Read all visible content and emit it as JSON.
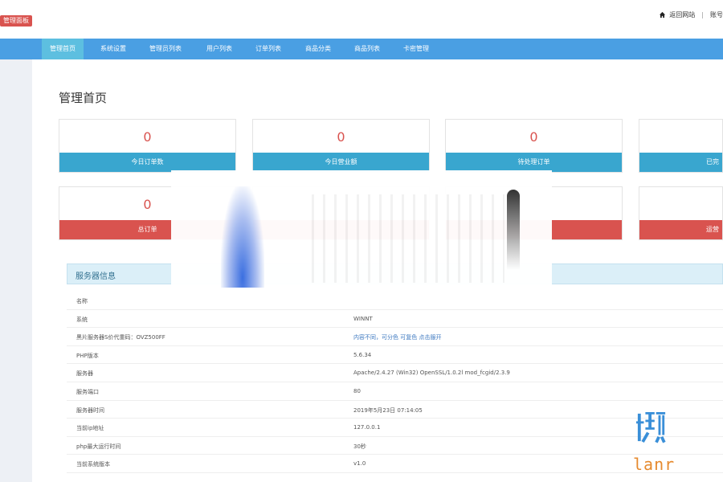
{
  "header": {
    "badge": "管理面板",
    "back_link": "返回网站",
    "separator": "|",
    "account_prefix": "账号"
  },
  "nav": {
    "items": [
      {
        "label": "管理首页",
        "active": true
      },
      {
        "label": "系统设置"
      },
      {
        "label": "管理员列表"
      },
      {
        "label": "用户列表"
      },
      {
        "label": "订单列表"
      },
      {
        "label": "商品分类"
      },
      {
        "label": "商品列表"
      },
      {
        "label": "卡密管理"
      }
    ]
  },
  "page": {
    "title": "管理首页"
  },
  "cards_row1": [
    {
      "value": "0",
      "label": "今日订单数"
    },
    {
      "value": "0",
      "label": "今日营业额"
    },
    {
      "value": "0",
      "label": "待处理订单"
    },
    {
      "value": "",
      "label": "已完"
    }
  ],
  "cards_row2": [
    {
      "value": "0",
      "label": "总订单"
    },
    {
      "value": "",
      "label": ""
    },
    {
      "value": "",
      "label": ""
    },
    {
      "value": "",
      "label": "运营"
    }
  ],
  "server": {
    "title": "服务器信息",
    "rows": [
      {
        "label": "名称",
        "value": ""
      },
      {
        "label": "系统",
        "value": "WINNT"
      },
      {
        "label": "黑片服务器S价代重码：OVZ500FF",
        "value": "内容不同，可分色 可复色 点击服开"
      },
      {
        "label": "PHP版本",
        "value": "5.6.34"
      },
      {
        "label": "服务器",
        "value": "Apache/2.4.27 (Win32) OpenSSL/1.0.2l mod_fcgid/2.3.9"
      },
      {
        "label": "服务端口",
        "value": "80"
      },
      {
        "label": "服务器时间",
        "value": "2019年5月23日 07:14:05"
      },
      {
        "label": "当前ip地址",
        "value": "127.0.0.1"
      },
      {
        "label": "php最大运行时间",
        "value": "30秒"
      },
      {
        "label": "当前系统版本",
        "value": "v1.0"
      }
    ]
  },
  "brand": {
    "glyph": "懒",
    "text": "lanr"
  },
  "colors": {
    "nav": "#4a9fe3",
    "active_tab": "#5dbfe0",
    "blue_bar": "#39a6cf",
    "red": "#d9534f"
  }
}
